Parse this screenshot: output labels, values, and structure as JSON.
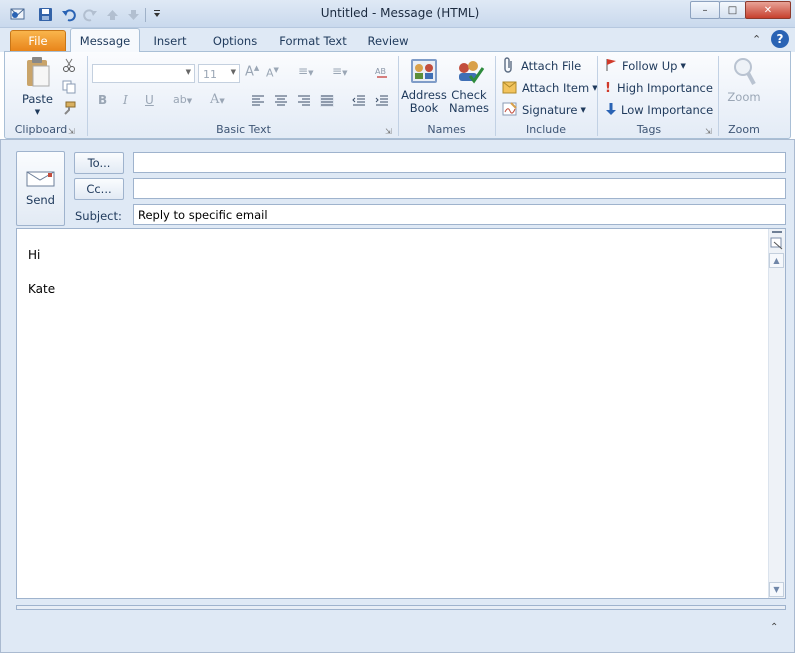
{
  "window": {
    "title": "Untitled  -  Message (HTML)",
    "minimize_glyph": "–",
    "maximize_glyph": "□",
    "close_glyph": "✕"
  },
  "tabs": [
    {
      "label": "File"
    },
    {
      "label": "Message"
    },
    {
      "label": "Insert"
    },
    {
      "label": "Options"
    },
    {
      "label": "Format Text"
    },
    {
      "label": "Review"
    }
  ],
  "ribbon": {
    "clipboard": {
      "paste_label": "Paste",
      "group_label": "Clipboard"
    },
    "basic_text": {
      "font_name": "",
      "font_size": "11",
      "group_label": "Basic Text",
      "bold": "B",
      "italic": "I",
      "underline": "U"
    },
    "names": {
      "address_book_line1": "Address",
      "address_book_line2": "Book",
      "check_names_line1": "Check",
      "check_names_line2": "Names",
      "group_label": "Names"
    },
    "include": {
      "attach_file": "Attach File",
      "attach_item": "Attach Item",
      "signature": "Signature",
      "group_label": "Include"
    },
    "tags": {
      "follow_up": "Follow Up",
      "high_importance": "High Importance",
      "low_importance": "Low Importance",
      "group_label": "Tags"
    },
    "zoom": {
      "zoom_button": "Zoom",
      "group_label": "Zoom"
    }
  },
  "compose": {
    "send_label": "Send",
    "to_label": "To...",
    "cc_label": "Cc...",
    "subject_label": "Subject:",
    "to_value": "",
    "cc_value": "",
    "subject_value": "Reply to specific email",
    "body_lines": [
      "Hi",
      "Kate"
    ]
  },
  "colors": {
    "file_tab": "#e8841a",
    "accent": "#1e395b",
    "close_button": "#c7402e"
  },
  "icons": [
    "outlook-icon",
    "save-icon",
    "undo-icon",
    "redo-icon",
    "up-icon",
    "down-icon",
    "customize-qat-icon",
    "paste-icon",
    "cut-icon",
    "copy-icon",
    "format-painter-icon",
    "address-book-icon",
    "check-names-icon",
    "paperclip-icon",
    "attach-item-icon",
    "signature-icon",
    "flag-icon",
    "high-importance-icon",
    "low-importance-icon",
    "zoom-icon",
    "help-icon",
    "send-icon"
  ]
}
